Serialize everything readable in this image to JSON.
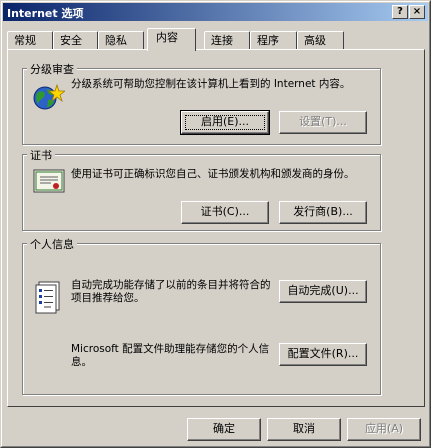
{
  "window": {
    "title": "Internet 选项"
  },
  "titlebar": {
    "help_glyph": "?",
    "close_glyph": "×"
  },
  "tabs": [
    {
      "label": "常规"
    },
    {
      "label": "安全"
    },
    {
      "label": "隐私"
    },
    {
      "label": "内容"
    },
    {
      "label": "连接"
    },
    {
      "label": "程序"
    },
    {
      "label": "高级"
    }
  ],
  "active_tab": "内容",
  "content_advisor": {
    "group_label": "分级审查",
    "description": "分级系统可帮助您控制在该计算机上看到的 Internet 内容。",
    "enable_label": "启用(E)...",
    "settings_label": "设置(T)..."
  },
  "certificates": {
    "group_label": "证书",
    "description": "使用证书可正确标识您自己、证书颁发机构和颁发商的身份。",
    "certificates_label": "证书(C)...",
    "publishers_label": "发行商(B)..."
  },
  "personal_info": {
    "group_label": "个人信息",
    "autocomplete_description": "自动完成功能存储了以前的条目并将符合的项目推荐给您。",
    "autocomplete_label": "自动完成(U)...",
    "profile_description": "Microsoft 配置文件助理能存储您的个人信息。",
    "profile_label": "配置文件(R)..."
  },
  "footer": {
    "ok_label": "确定",
    "cancel_label": "取消",
    "apply_label": "应用(A)"
  }
}
